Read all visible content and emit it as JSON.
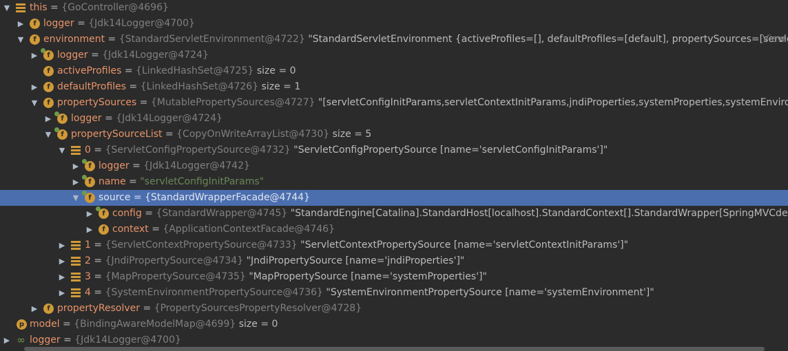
{
  "rows": [
    {
      "arrow": "▼",
      "icon": "list",
      "name": "this",
      "ref": "{GoController@4696}",
      "value": "",
      "str": "",
      "size": "",
      "view": ""
    },
    {
      "arrow": "▶",
      "icon": "field",
      "name": "logger",
      "ref": "{Jdk14Logger@4700}",
      "value": "",
      "str": "",
      "size": "",
      "view": ""
    },
    {
      "arrow": "▼",
      "icon": "field",
      "name": "environment",
      "ref": "{StandardServletEnvironment@4722}",
      "value": "\"StandardServletEnvironment {activeProfiles=[], defaultProfiles=[default], propertySources=[servletC...",
      "str": "",
      "size": "",
      "view": "View"
    },
    {
      "arrow": "▶",
      "icon": "field-arr",
      "name": "logger",
      "ref": "{Jdk14Logger@4724}",
      "value": "",
      "str": "",
      "size": "",
      "view": ""
    },
    {
      "arrow": "",
      "icon": "field",
      "name": "activeProfiles",
      "ref": "{LinkedHashSet@4725}",
      "value": "",
      "str": "",
      "size": "size = 0",
      "view": ""
    },
    {
      "arrow": "▶",
      "icon": "field",
      "name": "defaultProfiles",
      "ref": "{LinkedHashSet@4726}",
      "value": "",
      "str": "",
      "size": "size = 1",
      "view": ""
    },
    {
      "arrow": "▼",
      "icon": "field",
      "name": "propertySources",
      "ref": "{MutablePropertySources@4727}",
      "value": "\"[servletConfigInitParams,servletContextInitParams,jndiProperties,systemProperties,systemEnvironment]\"",
      "str": "",
      "size": "",
      "view": ""
    },
    {
      "arrow": "▶",
      "icon": "field-arr",
      "name": "logger",
      "ref": "{Jdk14Logger@4724}",
      "value": "",
      "str": "",
      "size": "",
      "view": ""
    },
    {
      "arrow": "▼",
      "icon": "field-arr",
      "name": "propertySourceList",
      "ref": "{CopyOnWriteArrayList@4730}",
      "value": "",
      "str": "",
      "size": "size = 5",
      "view": ""
    },
    {
      "arrow": "▼",
      "icon": "list",
      "name": "0",
      "ref": "{ServletConfigPropertySource@4732}",
      "value": "\"ServletConfigPropertySource [name='servletConfigInitParams']\"",
      "str": "",
      "size": "",
      "view": ""
    },
    {
      "arrow": "▶",
      "icon": "field-arr",
      "name": "logger",
      "ref": "{Jdk14Logger@4742}",
      "value": "",
      "str": "",
      "size": "",
      "view": ""
    },
    {
      "arrow": "▶",
      "icon": "field-arr",
      "name": "name",
      "ref": "",
      "value": "",
      "str": "\"servletConfigInitParams\"",
      "size": "",
      "view": ""
    },
    {
      "arrow": "▼",
      "icon": "field-arr",
      "name": "source",
      "ref": "{StandardWrapperFacade@4744}",
      "value": "",
      "str": "",
      "size": "",
      "view": "",
      "selected": true
    },
    {
      "arrow": "▶",
      "icon": "field-arr",
      "name": "config",
      "ref": "{StandardWrapper@4745}",
      "value": "\"StandardEngine[Catalina].StandardHost[localhost].StandardContext[].StandardWrapper[SpringMVCdemo]\"",
      "str": "",
      "size": "",
      "view": ""
    },
    {
      "arrow": "▶",
      "icon": "field",
      "name": "context",
      "ref": "{ApplicationContextFacade@4746}",
      "value": "",
      "str": "",
      "size": "",
      "view": ""
    },
    {
      "arrow": "▶",
      "icon": "list",
      "name": "1",
      "ref": "{ServletContextPropertySource@4733}",
      "value": "\"ServletContextPropertySource [name='servletContextInitParams']\"",
      "str": "",
      "size": "",
      "view": ""
    },
    {
      "arrow": "▶",
      "icon": "list",
      "name": "2",
      "ref": "{JndiPropertySource@4734}",
      "value": "\"JndiPropertySource [name='jndiProperties']\"",
      "str": "",
      "size": "",
      "view": ""
    },
    {
      "arrow": "▶",
      "icon": "list",
      "name": "3",
      "ref": "{MapPropertySource@4735}",
      "value": "\"MapPropertySource [name='systemProperties']\"",
      "str": "",
      "size": "",
      "view": ""
    },
    {
      "arrow": "▶",
      "icon": "list",
      "name": "4",
      "ref": "{SystemEnvironmentPropertySource@4736}",
      "value": "\"SystemEnvironmentPropertySource [name='systemEnvironment']\"",
      "str": "",
      "size": "",
      "view": ""
    },
    {
      "arrow": "▶",
      "icon": "field",
      "name": "propertyResolver",
      "ref": "{PropertySourcesPropertyResolver@4728}",
      "value": "",
      "str": "",
      "size": "",
      "view": ""
    },
    {
      "arrow": "",
      "icon": "param",
      "name": "model",
      "ref": "{BindingAwareModelMap@4699}",
      "value": "",
      "str": "",
      "size": "size = 0",
      "view": ""
    },
    {
      "arrow": "▶",
      "icon": "obj",
      "name": "logger",
      "ref": "{Jdk14Logger@4700}",
      "value": "",
      "str": "",
      "size": "",
      "view": ""
    }
  ],
  "icons": {
    "field": "f",
    "param": "p",
    "obj": "∞"
  }
}
